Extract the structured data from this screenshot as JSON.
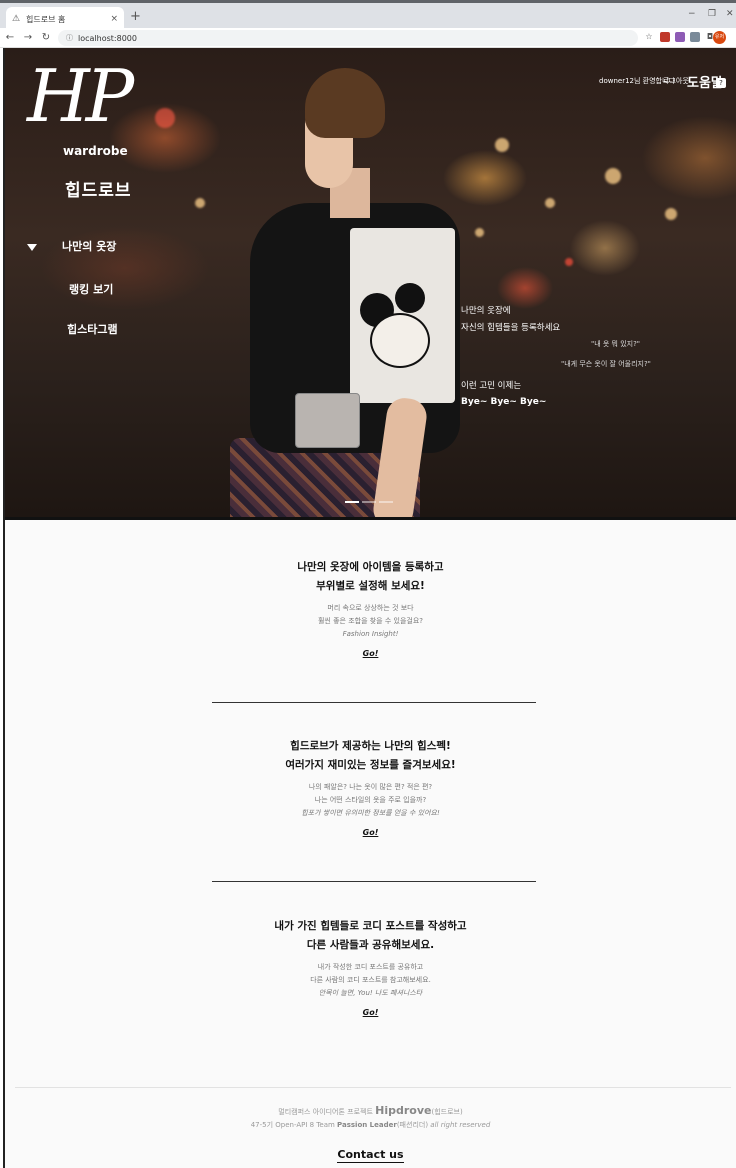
{
  "browser": {
    "tab_title": "힙드로브 홈",
    "tab_close": "×",
    "new_tab": "+",
    "url": "localhost:8000",
    "minimize": "−",
    "maximize": "❐",
    "close": "✕",
    "profile_initials": "유저"
  },
  "hero": {
    "logo": "HP",
    "brand_en": "wardrobe",
    "brand_kr": "힙드로브",
    "menu": [
      "나만의 옷장",
      "랭킹 보기",
      "힙스타그램"
    ],
    "top_links": [
      "downer12님 환영합니다",
      "로그아웃"
    ],
    "help_link": "도움말",
    "help_icon": "?",
    "copy": {
      "line1": "나만의 옷장에",
      "line2": "자신의 힙템들을 등록하세요",
      "quote1": "\"내 옷 뭐 있지?\"",
      "quote2": "\"내게 무슨 옷이 잘 어울리지?\"",
      "line3": "이런 고민 이제는",
      "line4": "Bye~ Bye~ Bye~"
    }
  },
  "sections": [
    {
      "title1": "나만의 옷장에 아이템을 등록하고",
      "title2": "부위별로 설정해 보세요!",
      "body1": "머리 속으로 상상하는 것 보다",
      "body2": "훨씬 좋은 조합을 찾을 수 있을걸요?",
      "body3": "Fashion Insight!",
      "go": "Go!"
    },
    {
      "title1": "힙드로브가 제공하는 나만의 힙스펙!",
      "title2": "여러가지 재미있는 정보를 즐겨보세요!",
      "body1": "나의 패알은? 나는 옷이 많은 편? 적은 편?",
      "body2": "나는 어떤 스타일의 옷을 주로 입을까?",
      "body3": "힙포가 쌓이면 유의미한 정보를 얻을 수 있어요!",
      "go": "Go!"
    },
    {
      "title1": "내가 가진 힙템들로 코디 포스트를 작성하고",
      "title2": "다른 사람들과 공유해보세요.",
      "body1": "내가 작성한 코디 포스트를 공유하고",
      "body2": "다른 사람의 코디 포스트를 참고해보세요.",
      "body3": "안목이 늘면, You! 나도 패셔니스타",
      "go": "Go!"
    }
  ],
  "footer": {
    "line1_pre": "멀티캠퍼스 아이디어톤 프로젝트",
    "line1_brand": "Hipdrove",
    "line1_post": "(힙드로브)",
    "line2_pre": "47-5기 Open-API 8 Team",
    "line2_team": "Passion Leader",
    "line2_mid": "(패션리더)",
    "line2_rights": "all right reserved",
    "contact": "Contact us"
  }
}
